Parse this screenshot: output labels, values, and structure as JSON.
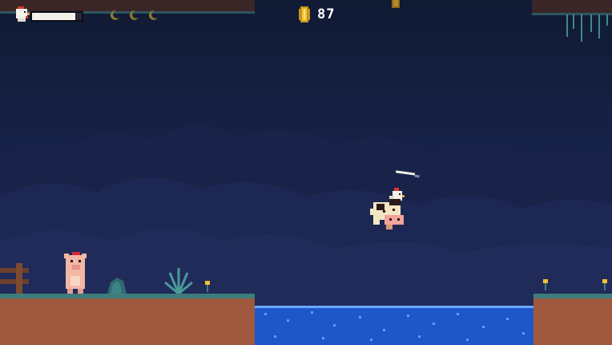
{
  "hud": {
    "coin_count": "87",
    "health_level": 0.87,
    "collected_moons": 0,
    "total_moons": 3
  },
  "colors": {
    "sky": "#17224a",
    "dirt": "#a0593e",
    "grass_edge": "#3d7c7a",
    "water": "#1f57c8",
    "coin": "#f2c233",
    "moon_empty": "#8a7a2e"
  },
  "icons": {
    "player_head": "chicken-head-icon",
    "moon": "crescent-moon-icon",
    "coin": "coin-icon"
  }
}
